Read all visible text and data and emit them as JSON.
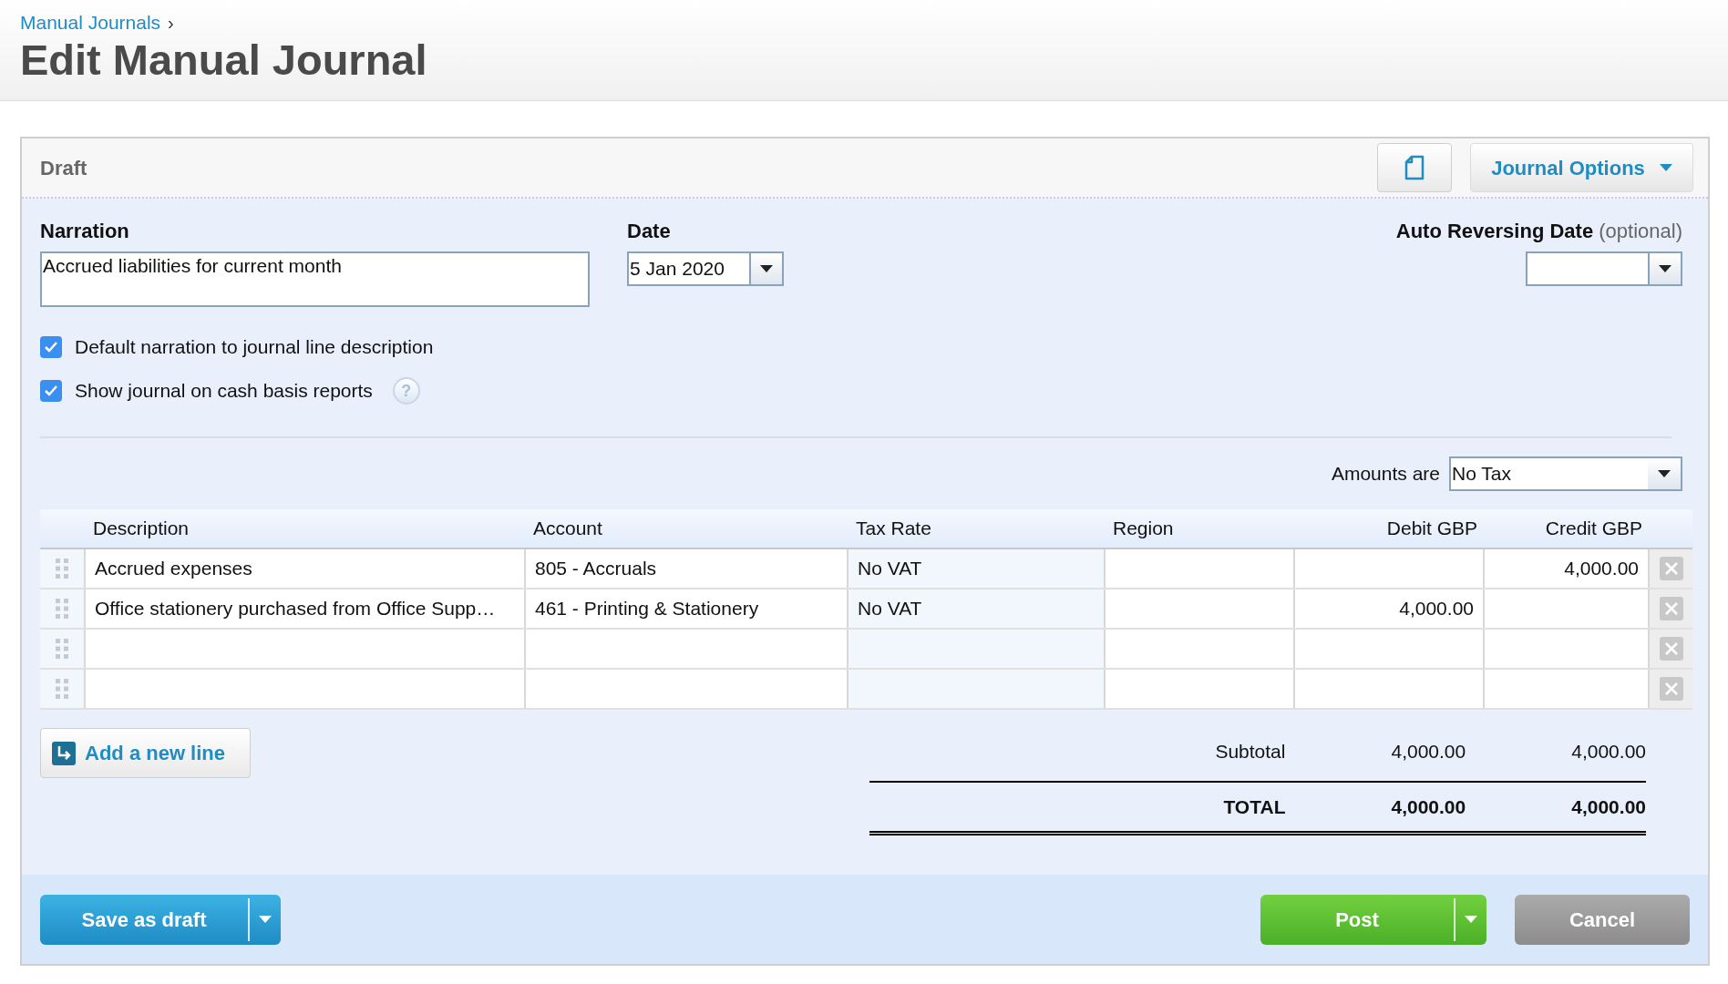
{
  "breadcrumb": {
    "label": "Manual Journals",
    "separator": "›"
  },
  "title": "Edit Manual Journal",
  "panel": {
    "status": "Draft",
    "options_button": "Journal Options"
  },
  "narration": {
    "label": "Narration",
    "value": "Accrued liabilities for current month"
  },
  "date": {
    "label": "Date",
    "value": "5 Jan 2020"
  },
  "auto_reversing_date": {
    "label": "Auto Reversing Date",
    "hint": "(optional)"
  },
  "options": [
    {
      "label": "Default narration to journal line description",
      "checked": true
    },
    {
      "label": "Show journal on cash basis reports",
      "checked": true,
      "help": "?"
    }
  ],
  "amounts_are": {
    "label": "Amounts are",
    "value": "No Tax"
  },
  "table": {
    "columns": [
      "Description",
      "Account",
      "Tax Rate",
      "Region",
      "Debit GBP",
      "Credit GBP"
    ],
    "rows": [
      {
        "description": "Accrued expenses",
        "account": "805 - Accruals",
        "tax_rate": "No VAT",
        "credit": "4,000.00"
      },
      {
        "description": "Office stationery purchased from Office Supp…",
        "account": "461 - Printing & Stationery",
        "tax_rate": "No VAT",
        "debit": "4,000.00"
      },
      {},
      {}
    ]
  },
  "add_line_button": "Add a new line",
  "totals": [
    {
      "kind": "subtotal",
      "label": "Subtotal",
      "debit": "4,000.00",
      "credit": "4,000.00"
    },
    {
      "kind": "total",
      "label": "TOTAL",
      "debit": "4,000.00",
      "credit": "4,000.00"
    }
  ],
  "footer": {
    "save_button": "Save as draft",
    "post_button": "Post",
    "cancel_button": "Cancel"
  }
}
